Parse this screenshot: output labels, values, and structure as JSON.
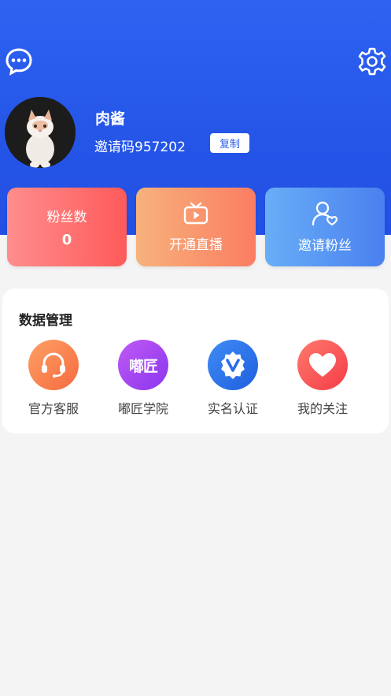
{
  "colors": {
    "header_bg": "#2556e8",
    "fans_card": "#ff6f6f",
    "live_card": "#f99a70",
    "invite_card": "#5a96f3",
    "service": "#fa7c4b",
    "academy": "#9b45f0",
    "verify": "#2f73ea",
    "follow": "#ff4f56"
  },
  "header": {
    "left_icon": "chat-bubble-icon",
    "right_icon": "gear-icon"
  },
  "profile": {
    "name": "肉酱",
    "invite_code": "邀请码957202",
    "copy_label": "复制"
  },
  "cards": {
    "fans_label": "粉丝数",
    "fans_value": "0",
    "live_label": "开通直播",
    "live_icon": "tv-icon",
    "invite_label": "邀请粉丝",
    "invite_icon": "user-heart-icon"
  },
  "panel": {
    "title": "数据管理",
    "items": [
      {
        "label": "官方客服",
        "icon": "headset-icon"
      },
      {
        "label": "嘟匠学院",
        "icon": "academy-logo-icon",
        "logo_text": "嘟匠"
      },
      {
        "label": "实名认证",
        "icon": "verified-badge-icon"
      },
      {
        "label": "我的关注",
        "icon": "heart-icon"
      }
    ]
  }
}
